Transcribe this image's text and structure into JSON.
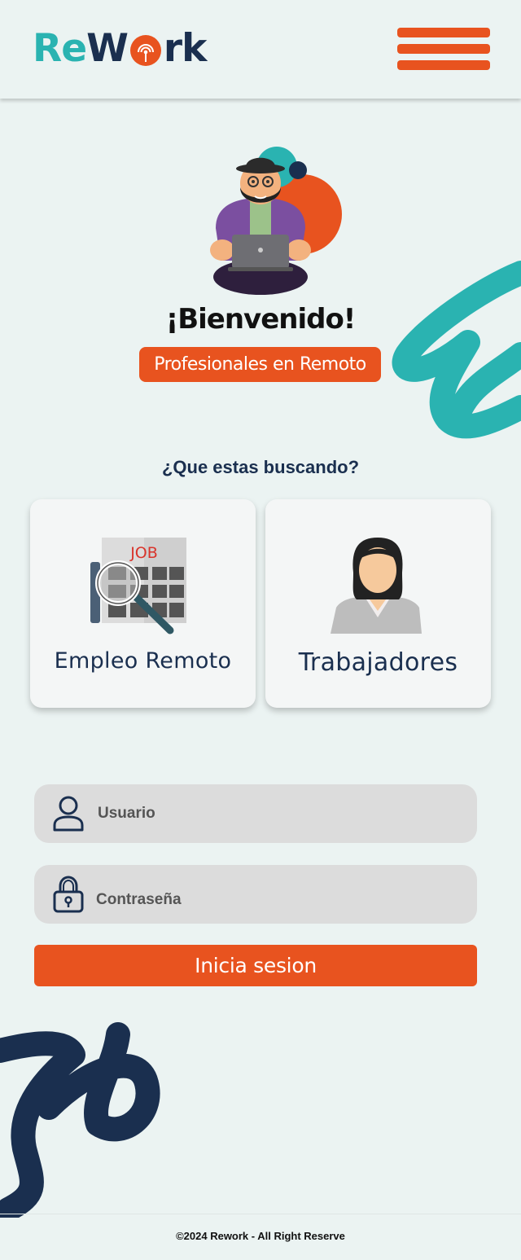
{
  "header": {
    "logo_re": "Re",
    "logo_w": "W",
    "logo_rk": "rk",
    "menu_icon": "hamburger-icon"
  },
  "hero": {
    "welcome": "¡Bienvenido!",
    "tagline": "Profesionales en Remoto",
    "illustration": "remote-worker-illustration"
  },
  "search": {
    "question": "¿Que estas buscando?",
    "options": [
      {
        "label": "Empleo Remoto",
        "icon": "job-search-icon",
        "icon_text": "JOB"
      },
      {
        "label": "Trabajadores",
        "icon": "worker-avatar-icon"
      }
    ]
  },
  "login": {
    "username_placeholder": "Usuario",
    "username_icon": "user-icon",
    "password_placeholder": "Contraseña",
    "password_icon": "lock-icon",
    "submit_label": "Inicia sesion"
  },
  "footer": {
    "text": "©2024 Rework - All Right Reserve"
  },
  "colors": {
    "background": "#ebf3f2",
    "accent": "#e8531f",
    "teal": "#2ab3b1",
    "navy": "#1a2f4f"
  }
}
